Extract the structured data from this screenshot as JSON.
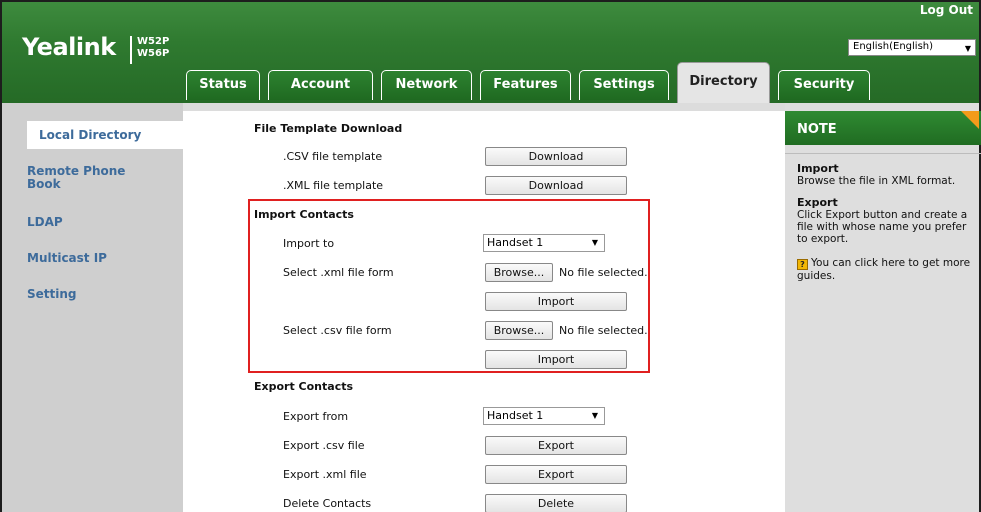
{
  "header": {
    "brand": "Yealink",
    "model_line1": "W52P",
    "model_line2": "W56P",
    "logout": "Log Out",
    "language": "English(English)"
  },
  "tabs": [
    {
      "label": "Status",
      "active": false
    },
    {
      "label": "Account",
      "active": false
    },
    {
      "label": "Network",
      "active": false
    },
    {
      "label": "Features",
      "active": false
    },
    {
      "label": "Settings",
      "active": false
    },
    {
      "label": "Directory",
      "active": true
    },
    {
      "label": "Security",
      "active": false
    }
  ],
  "sidebar": {
    "items": [
      {
        "label": "Local Directory",
        "active": true
      },
      {
        "label": "Remote Phone Book",
        "active": false
      },
      {
        "label": "LDAP",
        "active": false
      },
      {
        "label": "Multicast IP",
        "active": false
      },
      {
        "label": "Setting",
        "active": false
      }
    ]
  },
  "main": {
    "file_template": {
      "title": "File Template Download",
      "csv_label": ".CSV file template",
      "xml_label": ".XML file template",
      "download": "Download"
    },
    "import": {
      "title": "Import Contacts",
      "import_to_label": "Import to",
      "import_to_value": "Handset 1",
      "xml_label": "Select .xml file form",
      "csv_label": "Select .csv file form",
      "browse": "Browse...",
      "no_file": "No file selected.",
      "import_button": "Import"
    },
    "export": {
      "title": "Export Contacts",
      "export_from_label": "Export from",
      "export_from_value": "Handset 1",
      "csv_label": "Export .csv file",
      "xml_label": "Export .xml file",
      "delete_label": "Delete Contacts",
      "export_button": "Export",
      "delete_button": "Delete"
    }
  },
  "note": {
    "title": "NOTE",
    "import_title": "Import",
    "import_text": "Browse the file in XML format.",
    "export_title": "Export",
    "export_text": "Click Export button and create a file with whose name you prefer to export.",
    "help_text": "You can click here to get more guides."
  },
  "colors": {
    "header_green": "#2f7a30",
    "sidebar_link": "#3d6b9b",
    "note_corner": "#f39b1b",
    "highlight_box": "#e02020"
  }
}
